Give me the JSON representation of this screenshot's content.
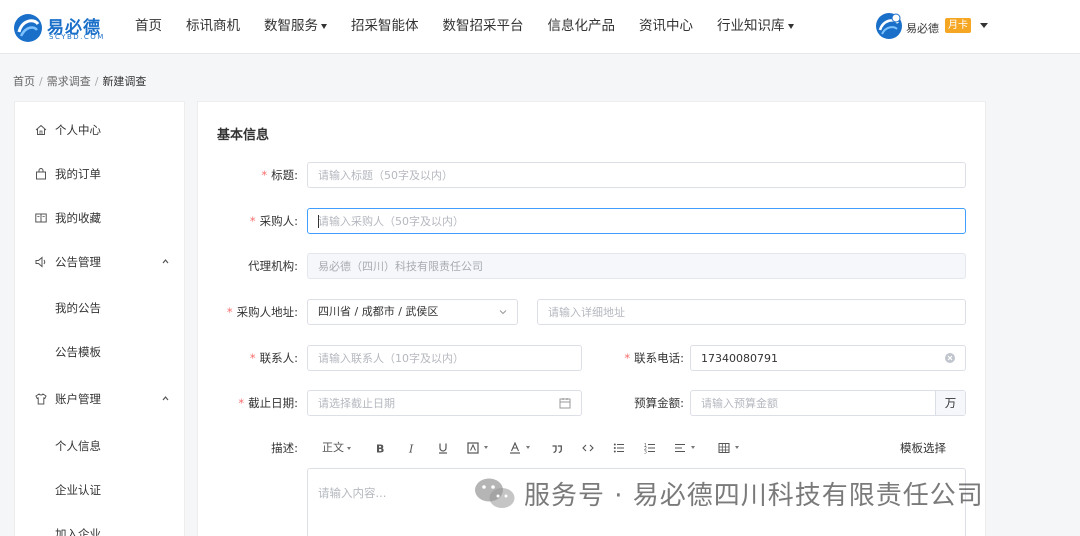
{
  "header": {
    "logo_name": "易必德",
    "logo_sub": "SCYBD.COM",
    "nav": [
      {
        "label": "首页",
        "dropdown": false
      },
      {
        "label": "标讯商机",
        "dropdown": false
      },
      {
        "label": "数智服务",
        "dropdown": true
      },
      {
        "label": "招采智能体",
        "dropdown": false
      },
      {
        "label": "数智招采平台",
        "dropdown": false
      },
      {
        "label": "信息化产品",
        "dropdown": false
      },
      {
        "label": "资讯中心",
        "dropdown": false
      },
      {
        "label": "行业知识库",
        "dropdown": true
      }
    ],
    "user_name": "易必德",
    "user_badge": "月卡"
  },
  "breadcrumb": {
    "items": [
      "首页",
      "需求调查"
    ],
    "current": "新建调查"
  },
  "sidebar": {
    "items": [
      {
        "label": "个人中心",
        "icon": "home-icon"
      },
      {
        "label": "我的订单",
        "icon": "bag-icon"
      },
      {
        "label": "我的收藏",
        "icon": "book-icon"
      },
      {
        "label": "公告管理",
        "icon": "speaker-icon",
        "expanded": true
      },
      {
        "label": "我的公告",
        "sub": true
      },
      {
        "label": "公告模板",
        "sub": true
      },
      {
        "label": "账户管理",
        "icon": "shirt-icon",
        "expanded": true
      },
      {
        "label": "个人信息",
        "sub": true
      },
      {
        "label": "企业认证",
        "sub": true
      },
      {
        "label": "加入企业",
        "sub": true
      }
    ]
  },
  "form": {
    "section_title": "基本信息",
    "title": {
      "label": "标题",
      "placeholder": "请输入标题（50字及以内）"
    },
    "purchaser": {
      "label": "采购人",
      "placeholder": "请输入采购人（50字及以内）"
    },
    "agency": {
      "label": "代理机构",
      "value": "易必德（四川）科技有限责任公司"
    },
    "address": {
      "label": "采购人地址",
      "region": "四川省 / 成都市 / 武侯区",
      "detail_placeholder": "请输入详细地址"
    },
    "contact": {
      "label": "联系人",
      "placeholder": "请输入联系人（10字及以内）"
    },
    "phone": {
      "label": "联系电话",
      "value": "17340080791"
    },
    "deadline": {
      "label": "截止日期",
      "placeholder": "请选择截止日期"
    },
    "budget": {
      "label": "预算金额",
      "placeholder": "请输入预算金额",
      "unit": "万"
    },
    "description": {
      "label": "描述",
      "placeholder": "请输入内容...",
      "format_label": "正文",
      "template_button": "模板选择"
    }
  },
  "watermark": {
    "text": "服务号 · 易必德四川科技有限责任公司"
  },
  "colors": {
    "brand": "#1a6fc9",
    "required": "#f56c6c",
    "focus": "#409eff",
    "badge": "#f5a623"
  }
}
